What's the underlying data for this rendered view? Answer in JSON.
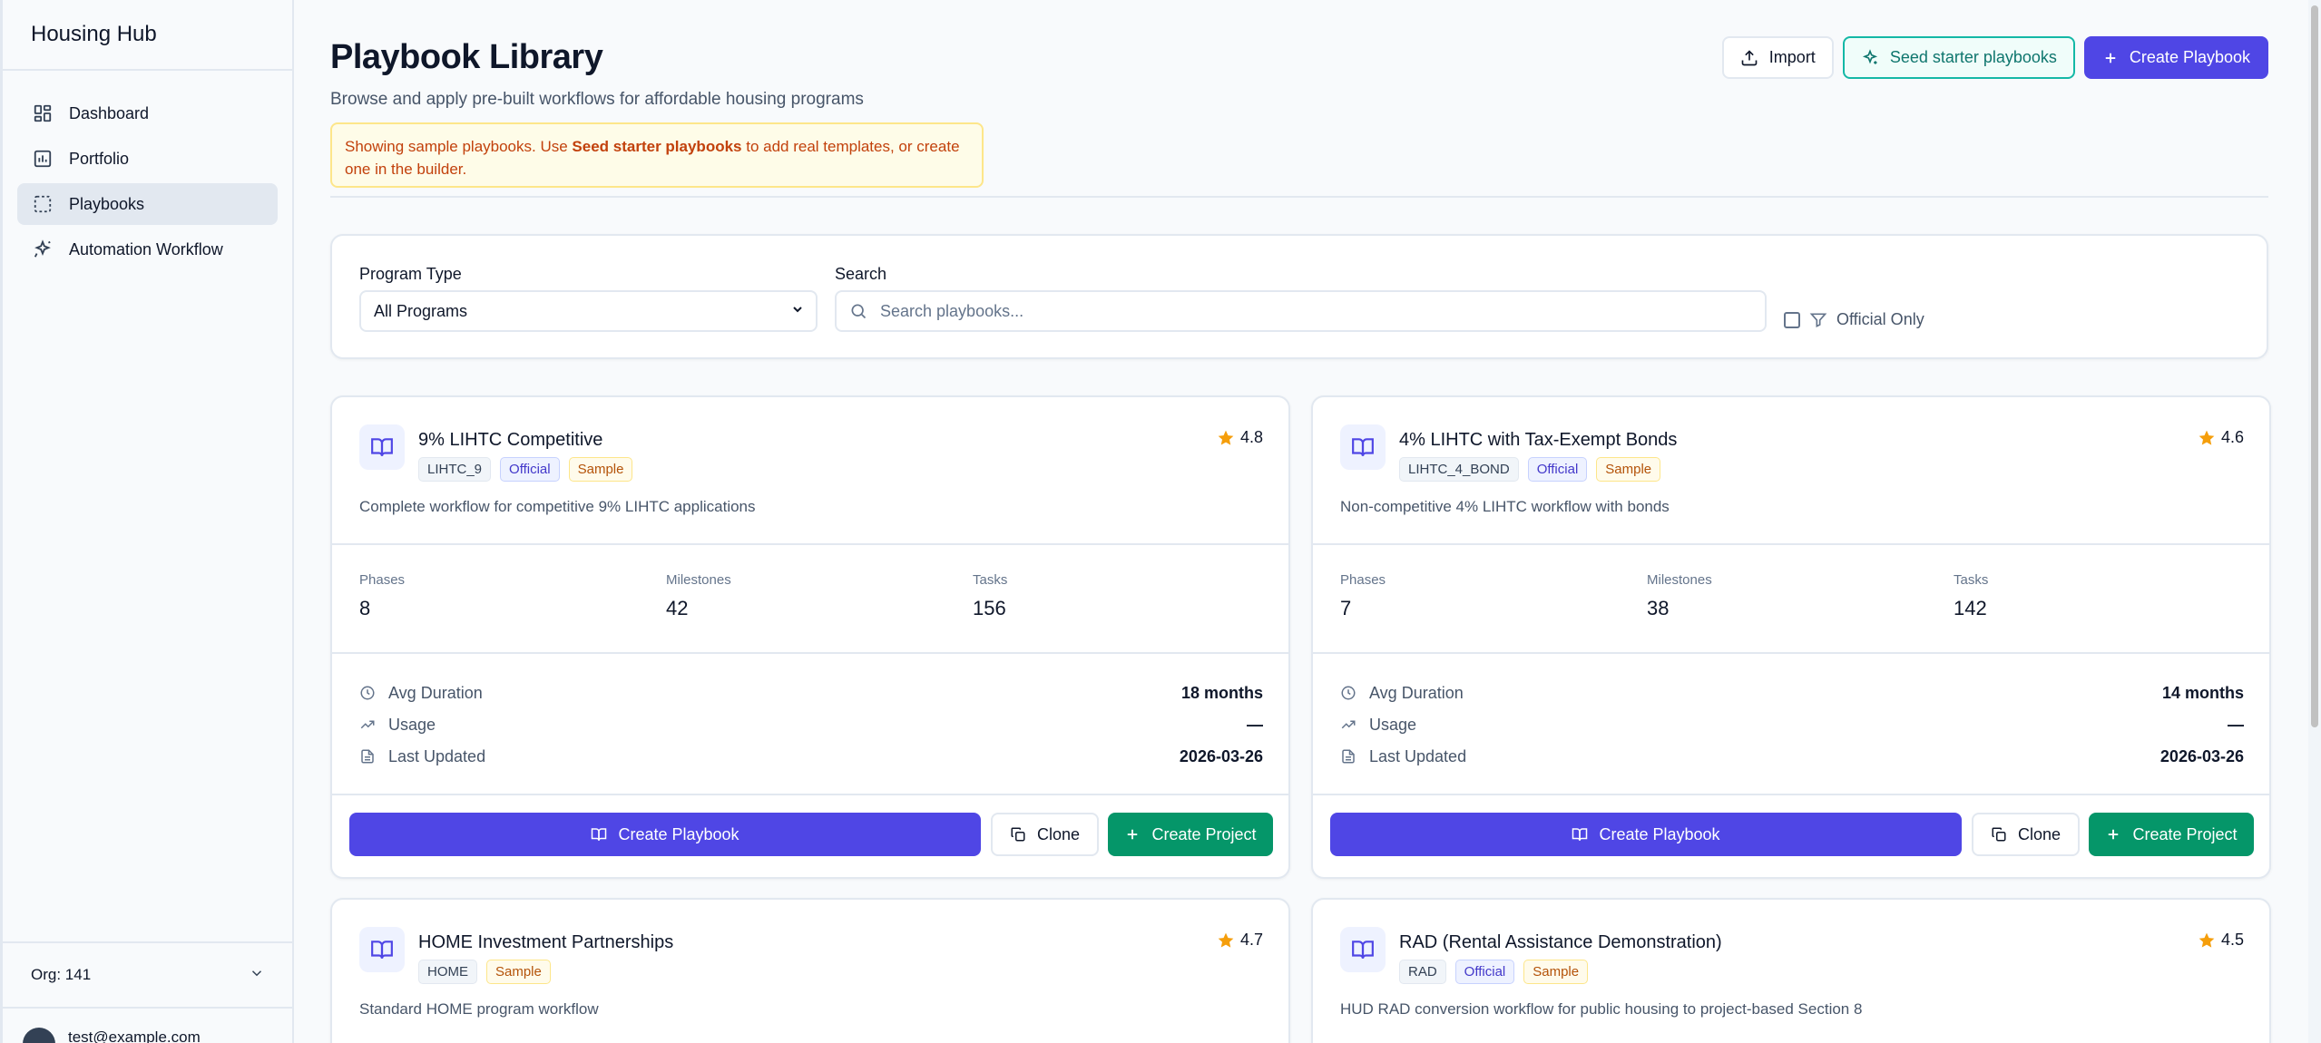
{
  "app": {
    "title": "Housing Hub"
  },
  "sidebar": {
    "items": [
      {
        "label": "Dashboard",
        "icon": "dashboard-icon"
      },
      {
        "label": "Portfolio",
        "icon": "portfolio-icon"
      },
      {
        "label": "Playbooks",
        "icon": "playbooks-icon",
        "active": true
      },
      {
        "label": "Automation Workflow",
        "icon": "automation-icon"
      }
    ],
    "org": "Org: 141",
    "user_email": "test@example.com"
  },
  "header": {
    "title": "Playbook Library",
    "subtitle": "Browse and apply pre-built workflows for affordable housing programs",
    "notice_prefix": "Showing sample playbooks. Use ",
    "notice_bold": "Seed starter playbooks",
    "notice_suffix": " to add real templates, or create one in the builder.",
    "import_label": "Import",
    "seed_label": "Seed starter playbooks",
    "create_label": "Create Playbook"
  },
  "filters": {
    "program_type_label": "Program Type",
    "program_type_value": "All Programs",
    "search_label": "Search",
    "search_placeholder": "Search playbooks...",
    "official_only_label": "Official Only"
  },
  "labels": {
    "phases": "Phases",
    "milestones": "Milestones",
    "tasks": "Tasks",
    "avg_duration": "Avg Duration",
    "usage": "Usage",
    "last_updated": "Last Updated",
    "create_playbook": "Create Playbook",
    "clone": "Clone",
    "create_project": "Create Project"
  },
  "playbooks": [
    {
      "title": "9% LIHTC Competitive",
      "code": "LIHTC_9",
      "official": "Official",
      "sample": "Sample",
      "rating": "4.8",
      "description": "Complete workflow for competitive 9% LIHTC applications",
      "phases": "8",
      "milestones": "42",
      "tasks": "156",
      "avg_duration": "18 months",
      "usage": "—",
      "last_updated": "2026-03-26"
    },
    {
      "title": "4% LIHTC with Tax-Exempt Bonds",
      "code": "LIHTC_4_BOND",
      "official": "Official",
      "sample": "Sample",
      "rating": "4.6",
      "description": "Non-competitive 4% LIHTC workflow with bonds",
      "phases": "7",
      "milestones": "38",
      "tasks": "142",
      "avg_duration": "14 months",
      "usage": "—",
      "last_updated": "2026-03-26"
    },
    {
      "title": "HOME Investment Partnerships",
      "code": "HOME",
      "sample": "Sample",
      "rating": "4.7",
      "description": "Standard HOME program workflow"
    },
    {
      "title": "RAD (Rental Assistance Demonstration)",
      "code": "RAD",
      "official": "Official",
      "sample": "Sample",
      "rating": "4.5",
      "description": "HUD RAD conversion workflow for public housing to project-based Section 8"
    }
  ],
  "colors": {
    "primary": "#4f46e5",
    "success": "#059669",
    "teal": "#0f766e",
    "star": "#f59e0b"
  }
}
